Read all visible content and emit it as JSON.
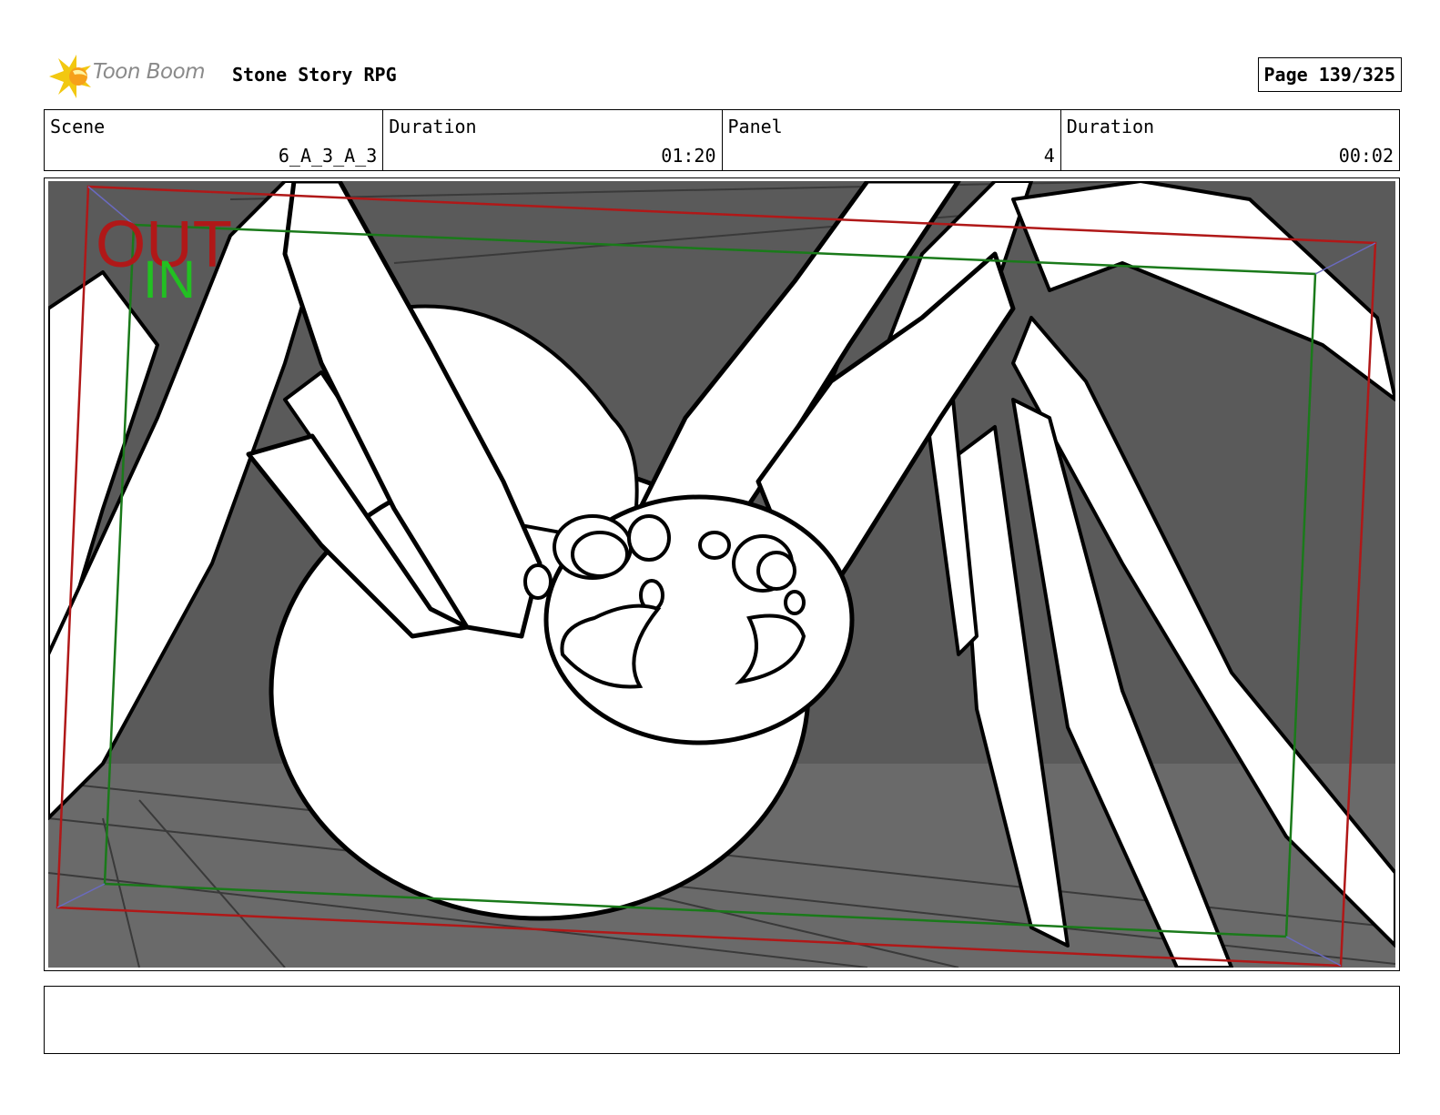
{
  "header": {
    "logo_text": "Toon Boom",
    "project_title": "Stone Story RPG",
    "page_label": "Page 139/325"
  },
  "info": {
    "scene_label": "Scene",
    "scene_value": "6_A_3_A_3",
    "scene_duration_label": "Duration",
    "scene_duration_value": "01:20",
    "panel_label": "Panel",
    "panel_value": "4",
    "panel_duration_label": "Duration",
    "panel_duration_value": "00:02"
  },
  "panel": {
    "out_label": "OUT",
    "in_label": "IN"
  },
  "colors": {
    "out_frame": "#b01818",
    "in_frame": "#1a7a1a",
    "in_text": "#22c022",
    "background": "#5a5a5a",
    "logo_yellow": "#f2c811"
  },
  "notes": ""
}
